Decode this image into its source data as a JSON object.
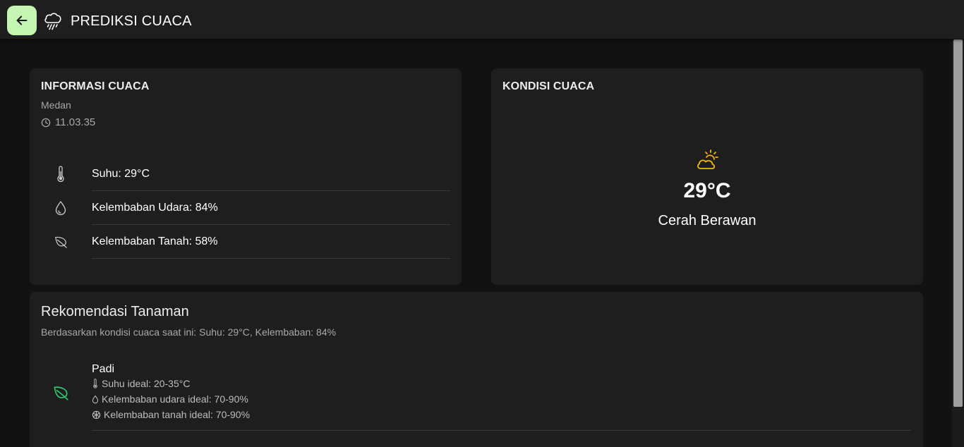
{
  "appbar": {
    "back_icon": "arrow-left-icon",
    "app_icon": "cloud-rain-icon",
    "title": "PREDIKSI CUACA",
    "back_button_color": "#c5f5b2"
  },
  "info_card": {
    "heading": "INFORMASI CUACA",
    "city": "Medan",
    "time_icon": "clock-icon",
    "time": "11.03.35",
    "items": [
      {
        "icon": "thermometer-icon",
        "text": "Suhu: 29°C"
      },
      {
        "icon": "droplet-icon",
        "text": "Kelembaban Udara: 84%"
      },
      {
        "icon": "leaf-icon",
        "text": "Kelembaban Tanah: 58%"
      }
    ]
  },
  "condition_card": {
    "heading": "KONDISI CUACA",
    "icon": "partly-cloudy-sun-icon",
    "icon_color": "#f5b800",
    "temperature": "29°C",
    "description": "Cerah Berawan"
  },
  "recommendation": {
    "title": "Rekomendasi Tanaman",
    "subtitle": "Berdasarkan kondisi cuaca saat ini: Suhu: 29°C, Kelembaban: 84%",
    "plants": [
      {
        "icon": "leaf-icon",
        "icon_color": "#2ecc71",
        "name": "Padi",
        "temp_ideal": "Suhu ideal: 20-35°C",
        "humidity_ideal": "Kelembaban udara ideal: 70-90%",
        "soil_ideal": "Kelembaban tanah ideal: 70-90%"
      }
    ]
  }
}
